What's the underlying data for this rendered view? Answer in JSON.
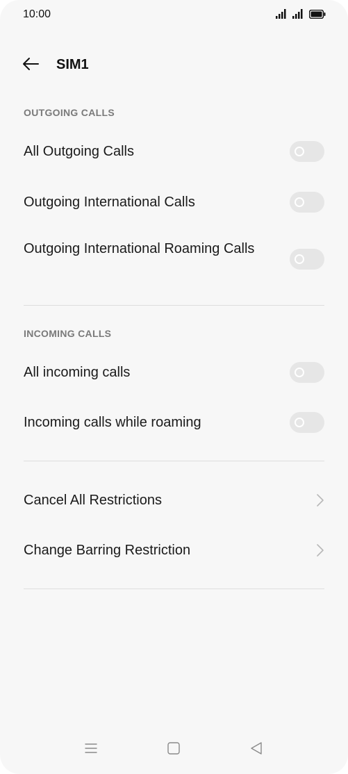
{
  "status_bar": {
    "time": "10:00",
    "icons": [
      "signal-icon",
      "signal-icon",
      "battery-icon"
    ]
  },
  "header": {
    "title": "SIM1",
    "back_icon": "back-arrow-icon"
  },
  "outgoing": {
    "section_label": "OUTGOING CALLS",
    "items": [
      {
        "label": "All Outgoing Calls",
        "enabled": false
      },
      {
        "label": "Outgoing International Calls",
        "enabled": false
      },
      {
        "label": "Outgoing International Roaming Calls",
        "enabled": false
      }
    ]
  },
  "incoming": {
    "section_label": "INCOMING CALLS",
    "items": [
      {
        "label": "All incoming calls",
        "enabled": false
      },
      {
        "label": "Incoming calls while roaming",
        "enabled": false
      }
    ]
  },
  "actions": {
    "items": [
      {
        "label": "Cancel All Restrictions",
        "icon": "chevron-right-icon"
      },
      {
        "label": "Change Barring Restriction",
        "icon": "chevron-right-icon"
      }
    ]
  },
  "nav_bar": {
    "icons": [
      "menu-icon",
      "home-icon",
      "back-icon"
    ]
  },
  "colors": {
    "background": "#f7f7f7",
    "toggle_off": "#e6e6e6",
    "section_label": "#7a7a7a",
    "divider": "#dedede"
  }
}
